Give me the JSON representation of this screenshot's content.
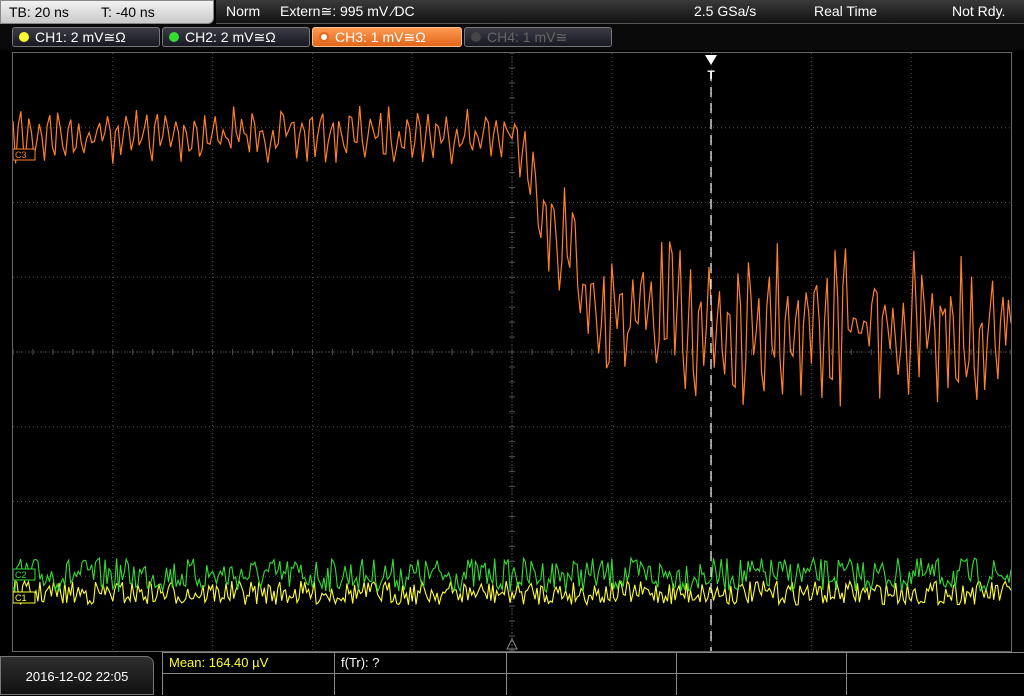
{
  "header": {
    "timebase": "TB: 20 ns",
    "trigger_time": "T: -40 ns",
    "mode": "Norm",
    "trigger_source": "Extern≅: 995 mV ⁄DC",
    "sample_rate": "2.5 GSa/s",
    "acquisition": "Real Time",
    "status": "Not Rdy."
  },
  "channels": [
    {
      "label": "CH1: 2 mV≅Ω",
      "color": "#ffff33",
      "active": true
    },
    {
      "label": "CH2: 2 mV≅Ω",
      "color": "#33dd33",
      "active": true
    },
    {
      "label": "CH3: 1 mV≅Ω",
      "color": "#ff7f2a",
      "active": true,
      "selected": true
    },
    {
      "label": "CH4: 1 mV≅",
      "color": "#666666",
      "active": false
    }
  ],
  "markers": {
    "ch3": "C3",
    "ch2": "C2",
    "ch1": "C1",
    "trigger": "T"
  },
  "footer": {
    "datetime": "2016-12-02 22:05",
    "mean_label": "Mean: 164.40 µV",
    "ftr_label": "f(Tr): ?"
  },
  "colors": {
    "ch1": "#ffff33",
    "ch2": "#33dd33",
    "ch3": "#ff7f2a",
    "grid": "#505050"
  }
}
